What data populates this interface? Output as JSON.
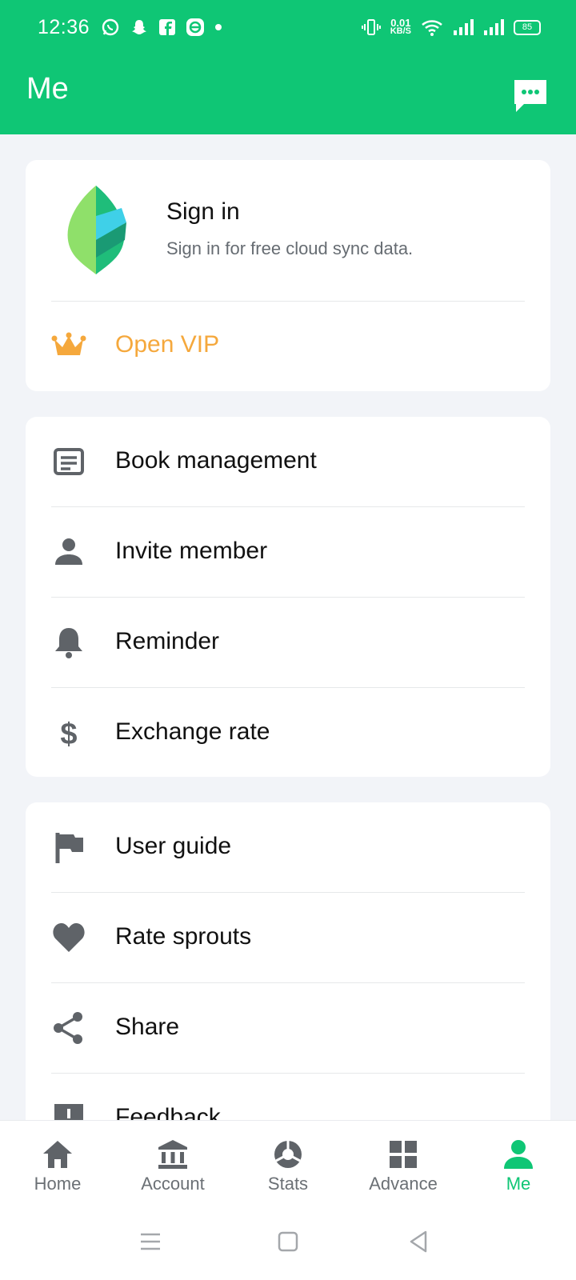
{
  "status_bar": {
    "time": "12:36",
    "net_speed_value": "0.01",
    "net_speed_unit": "KB/S",
    "battery": "85"
  },
  "header": {
    "title": "Me",
    "bg_color": "#0fc675"
  },
  "profile": {
    "sign_in_title": "Sign in",
    "sign_in_subtitle": "Sign in for free cloud sync data.",
    "vip_label": "Open VIP",
    "vip_color": "#f5a83c"
  },
  "menu_group_1": [
    {
      "label": "Book management",
      "icon": "book-icon"
    },
    {
      "label": "Invite member",
      "icon": "person-icon"
    },
    {
      "label": "Reminder",
      "icon": "bell-icon"
    },
    {
      "label": "Exchange rate",
      "icon": "dollar-icon"
    }
  ],
  "menu_group_2": [
    {
      "label": "User guide",
      "icon": "flag-icon"
    },
    {
      "label": "Rate sprouts",
      "icon": "heart-icon"
    },
    {
      "label": "Share",
      "icon": "share-icon"
    },
    {
      "label": "Feedback",
      "icon": "feedback-icon"
    }
  ],
  "bottom_nav": {
    "tabs": [
      {
        "label": "Home",
        "icon": "home-icon"
      },
      {
        "label": "Account",
        "icon": "bank-icon"
      },
      {
        "label": "Stats",
        "icon": "pie-icon"
      },
      {
        "label": "Advance",
        "icon": "grid-icon"
      },
      {
        "label": "Me",
        "icon": "person-icon"
      }
    ],
    "active_tab": "Me",
    "active_color": "#0fc675"
  }
}
